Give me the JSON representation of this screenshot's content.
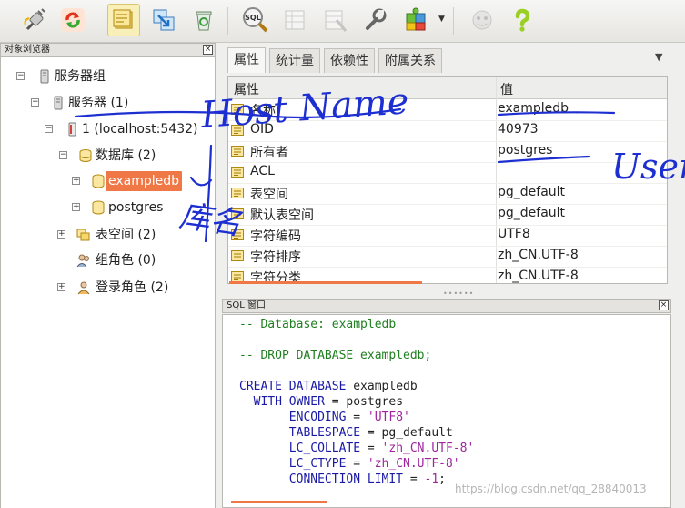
{
  "toolbar": {
    "buttons": [
      {
        "name": "connect-plug-icon",
        "active": false,
        "disabled": false
      },
      {
        "name": "refresh-icon",
        "active": false,
        "disabled": false
      },
      {
        "name": "object-properties-icon",
        "active": true,
        "disabled": false
      },
      {
        "name": "create-object-icon",
        "active": false,
        "disabled": false
      },
      {
        "name": "delete-recycle-icon",
        "active": false,
        "disabled": false
      },
      {
        "name": "sql-query-icon",
        "active": false,
        "disabled": false
      },
      {
        "name": "view-data-grid-icon",
        "active": false,
        "disabled": true
      },
      {
        "name": "filtered-data-icon",
        "active": false,
        "disabled": true
      },
      {
        "name": "maintenance-wrench-icon",
        "active": false,
        "disabled": false
      },
      {
        "name": "plugins-puzzle-icon",
        "active": false,
        "disabled": false
      },
      {
        "name": "guru-hints-icon",
        "active": false,
        "disabled": true
      },
      {
        "name": "help-question-icon",
        "active": false,
        "disabled": false
      }
    ],
    "sql_icon_text": "SQL"
  },
  "browser": {
    "title": "对象浏览器",
    "close": "×",
    "nodes": [
      {
        "label": "服务器组",
        "expander": "−",
        "icon": "server-group-icon"
      },
      {
        "label": "服务器 (1)",
        "expander": "−",
        "icon": "server-icon"
      },
      {
        "label": "1 (localhost:5432)",
        "expander": "−",
        "icon": "server-connected-icon"
      },
      {
        "label": "数据库 (2)",
        "expander": "−",
        "icon": "databases-icon"
      },
      {
        "label": "exampledb",
        "expander": "+",
        "icon": "database-icon",
        "selected": true
      },
      {
        "label": "postgres",
        "expander": "+",
        "icon": "database-icon"
      },
      {
        "label": "表空间 (2)",
        "expander": "+",
        "icon": "tablespaces-icon"
      },
      {
        "label": "组角色 (0)",
        "expander": "",
        "icon": "group-roles-icon"
      },
      {
        "label": "登录角色 (2)",
        "expander": "+",
        "icon": "login-roles-icon"
      }
    ]
  },
  "tabs": [
    {
      "label": "属性",
      "active": true
    },
    {
      "label": "统计量",
      "active": false
    },
    {
      "label": "依赖性",
      "active": false
    },
    {
      "label": "附属关系",
      "active": false
    }
  ],
  "tab_menu": "▼",
  "properties": {
    "headers": {
      "key": "属性",
      "value": "值"
    },
    "rows": [
      {
        "key": "名称",
        "value": "exampledb"
      },
      {
        "key": "OID",
        "value": "40973"
      },
      {
        "key": "所有者",
        "value": "postgres"
      },
      {
        "key": "ACL",
        "value": ""
      },
      {
        "key": "表空间",
        "value": "pg_default"
      },
      {
        "key": "默认表空间",
        "value": "pg_default"
      },
      {
        "key": "字符编码",
        "value": "UTF8"
      },
      {
        "key": "字符排序",
        "value": "zh_CN.UTF-8"
      },
      {
        "key": "字符分类",
        "value": "zh_CN.UTF-8"
      }
    ]
  },
  "sql_pane": {
    "title": "SQL 窗口",
    "close": "×",
    "lines": [
      [
        {
          "t": "-- Database: exampledb",
          "c": "comment"
        }
      ],
      [],
      [
        {
          "t": "-- DROP DATABASE exampledb;",
          "c": "comment"
        }
      ],
      [],
      [
        {
          "t": "CREATE DATABASE",
          "c": "kw"
        },
        {
          "t": " exampledb",
          "c": ""
        }
      ],
      [
        {
          "t": "  WITH OWNER",
          "c": "kw"
        },
        {
          "t": " = postgres",
          "c": ""
        }
      ],
      [
        {
          "t": "       ENCODING",
          "c": "kw"
        },
        {
          "t": " = ",
          "c": ""
        },
        {
          "t": "'UTF8'",
          "c": "str"
        }
      ],
      [
        {
          "t": "       TABLESPACE",
          "c": "kw"
        },
        {
          "t": " = pg_default",
          "c": ""
        }
      ],
      [
        {
          "t": "       LC_COLLATE",
          "c": "kw"
        },
        {
          "t": " = ",
          "c": ""
        },
        {
          "t": "'zh_CN.UTF-8'",
          "c": "str"
        }
      ],
      [
        {
          "t": "       LC_CTYPE",
          "c": "kw"
        },
        {
          "t": " = ",
          "c": ""
        },
        {
          "t": "'zh_CN.UTF-8'",
          "c": "str"
        }
      ],
      [
        {
          "t": "       CONNECTION LIMIT",
          "c": "kw"
        },
        {
          "t": " = ",
          "c": ""
        },
        {
          "t": "-1",
          "c": "num"
        },
        {
          "t": ";",
          "c": ""
        }
      ]
    ]
  },
  "watermark": "https://blog.csdn.net/qq_28840013",
  "annotations": {
    "host_name": "Host Name",
    "user": "User",
    "db_name": "库名"
  },
  "colors": {
    "selection": "#f07746",
    "annotation_ink": "#1d2fd1",
    "comment": "#1f7f1f",
    "keyword": "#1a1aa6",
    "string": "#a0249f"
  }
}
